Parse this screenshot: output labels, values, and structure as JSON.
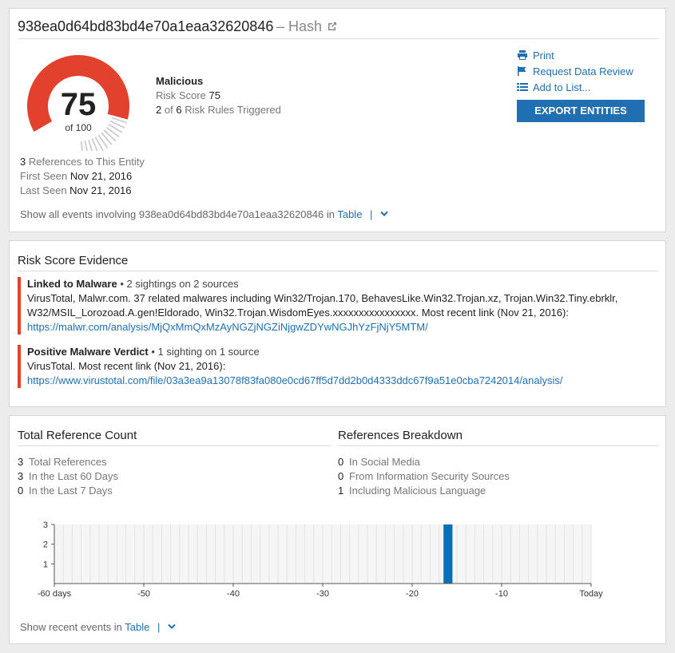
{
  "entity": {
    "hash": "938ea0d64bd83bd4e70a1eaa32620846",
    "type_label": "– Hash",
    "risk": {
      "score": "75",
      "score_value": 75,
      "of_label": "of 100",
      "verdict": "Malicious",
      "risk_score_label": "Risk Score",
      "rules_triggered": "2",
      "rules_of": "of",
      "rules_total": "6",
      "rules_label": "Risk Rules Triggered",
      "color": "#e1412d"
    },
    "actions": {
      "print": "Print",
      "request_review": "Request Data Review",
      "add_to_list": "Add to List...",
      "export": "EXPORT ENTITIES"
    },
    "references": {
      "count": "3",
      "count_label": "References to This Entity",
      "first_seen_label": "First Seen",
      "first_seen": "Nov 21, 2016",
      "last_seen_label": "Last Seen",
      "last_seen": "Nov 21, 2016"
    },
    "show_all": {
      "prefix": "Show all events involving 938ea0d64bd83bd4e70a1eaa32620846 in",
      "link": "Table"
    }
  },
  "evidence": {
    "title": "Risk Score Evidence",
    "items": [
      {
        "rule": "Linked to Malware",
        "summary": " • 2 sightings on 2 sources",
        "text": "VirusTotal, Malwr.com. 37 related malwares including Win32/Trojan.170, BehavesLike.Win32.Trojan.xz, Trojan.Win32.Tiny.ebrklr, W32/MSIL_Lorozoad.A.gen!Eldorado, Win32.Trojan.WisdomEyes.xxxxxxxxxxxxxxxx. Most recent link (Nov 21, 2016):",
        "link": "https://malwr.com/analysis/MjQxMmQxMzAyNGZjNGZiNjgwZDYwNGJhYzFjNjY5MTM/"
      },
      {
        "rule": "Positive Malware Verdict",
        "summary": " • 1 sighting on 1 source",
        "text": "VirusTotal. Most recent link (Nov 21, 2016):",
        "link": "https://www.virustotal.com/file/03a3ea9a13078f83fa080e0cd67ff5d7dd2b0d4333ddc67f9a51e0cba7242014/analysis/"
      }
    ]
  },
  "counts": {
    "total_title": "Total Reference Count",
    "breakdown_title": "References Breakdown",
    "total": [
      {
        "n": "3",
        "label": "Total References"
      },
      {
        "n": "3",
        "label": "In the Last 60 Days"
      },
      {
        "n": "0",
        "label": "In the Last 7 Days"
      }
    ],
    "breakdown": [
      {
        "n": "0",
        "label": "In Social Media"
      },
      {
        "n": "0",
        "label": "From Information Security Sources"
      },
      {
        "n": "1",
        "label": "Including Malicious Language"
      }
    ],
    "show_recent": {
      "prefix": "Show recent events in",
      "link": "Table"
    }
  },
  "chart_data": {
    "type": "bar",
    "x_ticks": [
      "-60 days",
      "-50",
      "-40",
      "-30",
      "-20",
      "-10",
      "Today"
    ],
    "x_tick_values": [
      -60,
      -50,
      -40,
      -30,
      -20,
      -10,
      0
    ],
    "y_ticks": [
      "1",
      "2",
      "3"
    ],
    "y_tick_values": [
      1,
      2,
      3
    ],
    "xlim": [
      -60,
      0
    ],
    "ylim": [
      0,
      3
    ],
    "bars": [
      {
        "x": -16,
        "value": 3
      }
    ],
    "bar_color": "#0a6fb5",
    "grid": true
  }
}
